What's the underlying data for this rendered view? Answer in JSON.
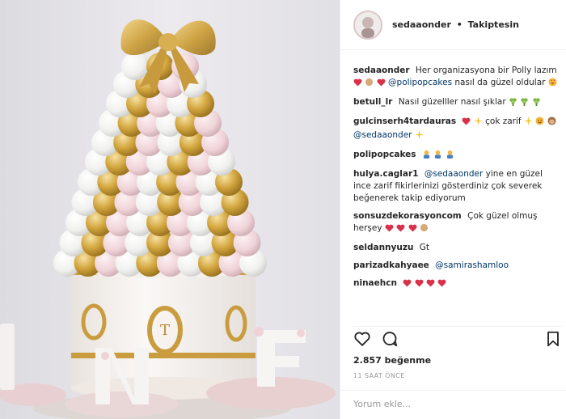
{
  "post": {
    "author": "sedaaonder",
    "separator": "•",
    "follow_status": "Takiptesin",
    "likes": "2.857 beğenme",
    "time_ago": "11 SAAT ÖNCE",
    "add_comment_placeholder": "Yorum ekle..."
  },
  "caption": {
    "user": "sedaaonder",
    "text_1": "Her organizasyona bir Polly lazım",
    "mention": "@polipopcakes",
    "text_2": "nasıl da güzel oldular"
  },
  "comments": [
    {
      "user": "betull_lr",
      "text": "Nasıl güzelller nasıl şıklar"
    },
    {
      "user": "gulcinserh4tardauras",
      "text": "çok zarif",
      "mention": "@sedaaonder"
    },
    {
      "user": "polipopcakes"
    },
    {
      "user": "hulya.caglar1",
      "mention": "@sedaaonder",
      "text": "yine en güzel ince zarif fikirlerinizi gösterdiniz çok severek beğenerek takip ediyorum"
    },
    {
      "user": "sonsuzdekorasyoncom",
      "text": "Çok güzel olmuş herşey"
    },
    {
      "user": "seldannyuzu",
      "text": "Gt"
    },
    {
      "user": "parizadkahyaee",
      "mention": "@samirashamloo"
    },
    {
      "user": "ninaehcn"
    }
  ],
  "photo": {
    "monogram": "T"
  },
  "colors": {
    "heart": "#d8324a",
    "mention": "#003569",
    "gold": "#d2a940",
    "pink": "#f2d9de"
  },
  "icons": {
    "like": "heart-outline-icon",
    "comment": "comment-bubble-icon",
    "save": "bookmark-icon"
  }
}
